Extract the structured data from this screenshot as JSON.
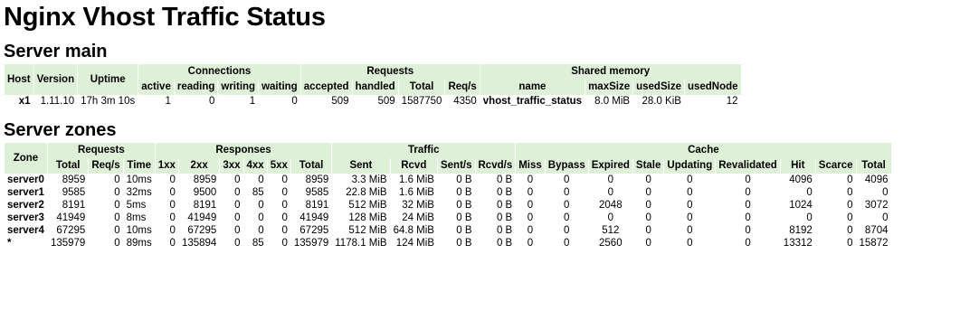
{
  "page_title": "Nginx Vhost Traffic Status",
  "server_main": {
    "title": "Server main",
    "group_headers": [
      "Connections",
      "Requests",
      "Shared memory"
    ],
    "headers": {
      "host": "Host",
      "version": "Version",
      "uptime": "Uptime",
      "active": "active",
      "reading": "reading",
      "writing": "writing",
      "waiting": "waiting",
      "accepted": "accepted",
      "handled": "handled",
      "total": "Total",
      "req_s": "Req/s",
      "name": "name",
      "max_size": "maxSize",
      "used_size": "usedSize",
      "used_node": "usedNode"
    },
    "row": {
      "host": "x1",
      "version": "1.11.10",
      "uptime": "17h 3m 10s",
      "active": "1",
      "reading": "0",
      "writing": "1",
      "waiting": "0",
      "accepted": "509",
      "handled": "509",
      "total": "1587750",
      "req_s": "4350",
      "name": "vhost_traffic_status",
      "max_size": "8.0 MiB",
      "used_size": "28.0 KiB",
      "used_node": "12"
    }
  },
  "server_zones": {
    "title": "Server zones",
    "zone_header": "Zone",
    "group_headers": [
      "Requests",
      "Responses",
      "Traffic",
      "Cache"
    ],
    "sub_headers": [
      "Total",
      "Req/s",
      "Time",
      "1xx",
      "2xx",
      "3xx",
      "4xx",
      "5xx",
      "Total",
      "Sent",
      "Rcvd",
      "Sent/s",
      "Rcvd/s",
      "Miss",
      "Bypass",
      "Expired",
      "Stale",
      "Updating",
      "Revalidated",
      "Hit",
      "Scarce",
      "Total"
    ],
    "rows": [
      {
        "zone": "server0",
        "cells": [
          "8959",
          "0",
          "10ms",
          "0",
          "8959",
          "0",
          "0",
          "0",
          "8959",
          "3.3 MiB",
          "1.6 MiB",
          "0 B",
          "0 B",
          "0",
          "0",
          "0",
          "0",
          "0",
          "0",
          "4096",
          "0",
          "4096"
        ]
      },
      {
        "zone": "server1",
        "cells": [
          "9585",
          "0",
          "32ms",
          "0",
          "9500",
          "0",
          "85",
          "0",
          "9585",
          "22.8 MiB",
          "1.6 MiB",
          "0 B",
          "0 B",
          "0",
          "0",
          "0",
          "0",
          "0",
          "0",
          "0",
          "0",
          "0"
        ]
      },
      {
        "zone": "server2",
        "cells": [
          "8191",
          "0",
          "5ms",
          "0",
          "8191",
          "0",
          "0",
          "0",
          "8191",
          "512 MiB",
          "32 MiB",
          "0 B",
          "0 B",
          "0",
          "0",
          "2048",
          "0",
          "0",
          "0",
          "1024",
          "0",
          "3072"
        ]
      },
      {
        "zone": "server3",
        "cells": [
          "41949",
          "0",
          "8ms",
          "0",
          "41949",
          "0",
          "0",
          "0",
          "41949",
          "128 MiB",
          "24 MiB",
          "0 B",
          "0 B",
          "0",
          "0",
          "0",
          "0",
          "0",
          "0",
          "0",
          "0",
          "0"
        ]
      },
      {
        "zone": "server4",
        "cells": [
          "67295",
          "0",
          "10ms",
          "0",
          "67295",
          "0",
          "0",
          "0",
          "67295",
          "512 MiB",
          "64.8 MiB",
          "0 B",
          "0 B",
          "0",
          "0",
          "512",
          "0",
          "0",
          "0",
          "8192",
          "0",
          "8704"
        ]
      },
      {
        "zone": "*",
        "cells": [
          "135979",
          "0",
          "89ms",
          "0",
          "135894",
          "0",
          "85",
          "0",
          "135979",
          "1178.1 MiB",
          "124 MiB",
          "0 B",
          "0 B",
          "0",
          "0",
          "2560",
          "0",
          "0",
          "0",
          "13312",
          "0",
          "15872"
        ]
      }
    ]
  }
}
